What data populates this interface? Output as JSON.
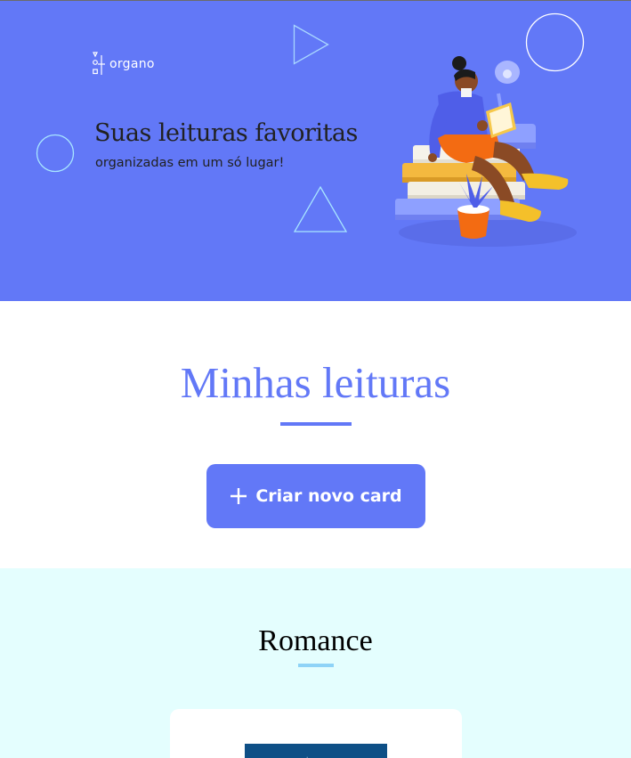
{
  "hero": {
    "logo_text": "organo",
    "title": "Suas leituras favoritas",
    "subtitle": "organizadas em um só lugar!",
    "illustration": "woman-reading-on-books-illustration"
  },
  "readings": {
    "title": "Minhas leituras",
    "create_button_label": "Criar novo card",
    "create_button_icon": "plus-icon"
  },
  "categories": [
    {
      "name": "Romance",
      "accent": "#8ed3f7",
      "background": "#e4fefe"
    }
  ],
  "colors": {
    "primary": "#6278f7",
    "text_dark": "#212121",
    "category_bg": "#e4fefe",
    "category_accent": "#8ed3f7"
  }
}
